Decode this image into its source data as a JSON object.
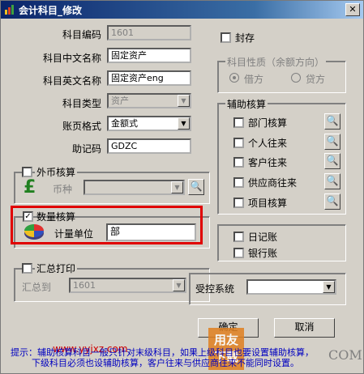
{
  "window": {
    "title": "会计科目_修改",
    "close_glyph": "✕"
  },
  "form": {
    "code_label": "科目编码",
    "code_value": "1601",
    "cn_name_label": "科目中文名称",
    "cn_name_value": "固定资产",
    "en_name_label": "科目英文名称",
    "en_name_value": "固定资产eng",
    "type_label": "科目类型",
    "type_value": "资产",
    "format_label": "账页格式",
    "format_value": "金额式",
    "mnemonic_label": "助记码",
    "mnemonic_value": "GDZC"
  },
  "seal": {
    "label": "封存",
    "checked": false
  },
  "nature": {
    "title": "科目性质（余额方向）",
    "debit": "借方",
    "credit": "贷方",
    "selected": "debit"
  },
  "aux": {
    "title": "辅助核算",
    "items": [
      {
        "label": "部门核算",
        "checked": false
      },
      {
        "label": "个人往来",
        "checked": false
      },
      {
        "label": "客户往来",
        "checked": false
      },
      {
        "label": "供应商往来",
        "checked": false
      },
      {
        "label": "项目核算",
        "checked": false
      }
    ]
  },
  "foreign": {
    "title": "外币核算",
    "checked": false,
    "currency_label": "币种",
    "currency_value": ""
  },
  "quantity": {
    "title": "数量核算",
    "checked": true,
    "unit_label": "计量单位",
    "unit_value": "部"
  },
  "journal": {
    "label": "日记账",
    "checked": false
  },
  "bank": {
    "label": "银行账",
    "checked": false
  },
  "summary": {
    "title": "汇总打印",
    "checked": false,
    "to_label": "汇总到",
    "to_value": "1601"
  },
  "controlled": {
    "label": "受控系统",
    "value": ""
  },
  "buttons": {
    "ok": "确定",
    "cancel": "取消"
  },
  "hint": {
    "line1": "提示：辅助核算科目一般只针对末级科目，如果上级科目也要设置辅助核算，",
    "line2": "下级科目必须也设辅助核算，客户往来与供应商往来不能同时设置。"
  },
  "watermark": {
    "url": "www.yyjxz.com",
    "brand1": "用友",
    "brand2": "下载",
    "com": "COM"
  },
  "colors": {
    "title_bar": "#0a246a",
    "highlight": "#e00000",
    "hint": "#0000c0"
  }
}
